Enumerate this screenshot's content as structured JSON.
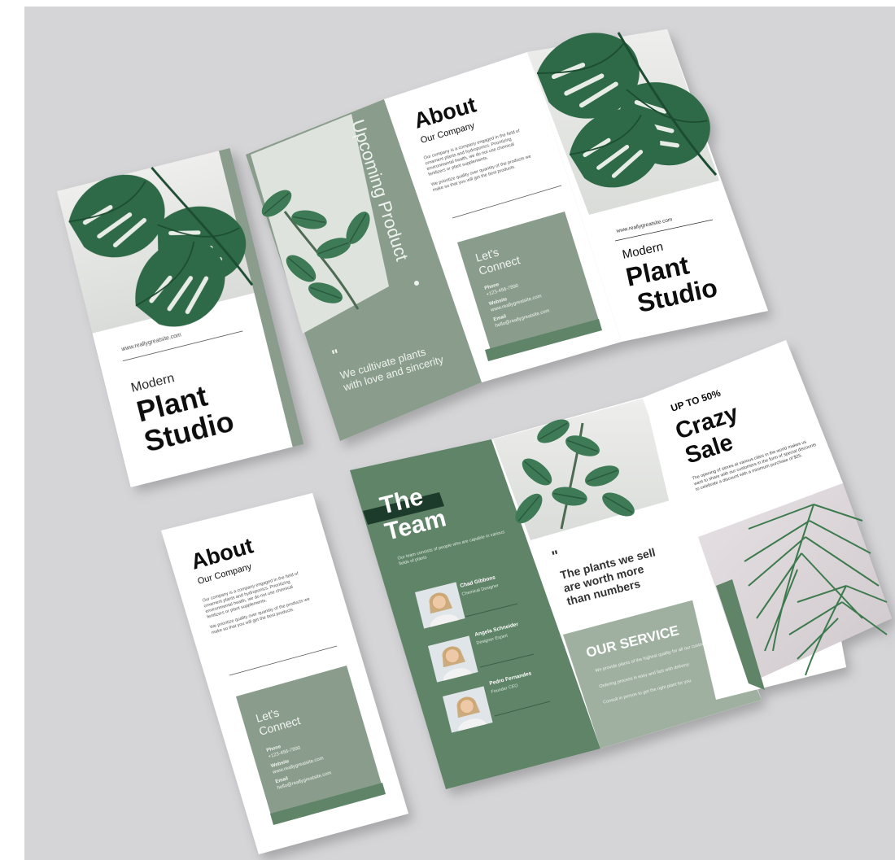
{
  "colors": {
    "background": "#d5d5d8",
    "sage": "#8a9d8c",
    "sage_light": "#9fb0a1",
    "forest": "#5f8468",
    "leaf_dark": "#2f6b47",
    "leaf_mid": "#4d8a62",
    "paper": "#ffffff",
    "text_dark": "#1b1b1b"
  },
  "icons": [
    "monstera-leaf-icon",
    "rubber-plant-icon",
    "palm-frond-icon",
    "quote-mark-icon",
    "portrait-avatar-icon"
  ],
  "website": "www.reallygreatsite.com",
  "brand": {
    "line1": "Modern",
    "line2": "Plant",
    "line3": "Studio"
  },
  "about": {
    "title": "About",
    "subtitle": "Our Company",
    "paragraph1": "Our company is a company engaged in the field of ornament plants and hydroponics. Prioritizing environmental health, we do not use chemical fertilizers or plant supplements.",
    "paragraph2": "We prioritize quality over quantity of the products we make so that you will get the best products."
  },
  "connect": {
    "title_line1": "Let's",
    "title_line2": "Connect",
    "phone_label": "Phone",
    "phone_value": "+123-456-7890",
    "website_label": "Website",
    "website_value": "www.reallygreatsite.com",
    "email_label": "Email",
    "email_value": "hello@reallygreatsite.com"
  },
  "upcoming": {
    "vertical_title": "Upcoming Product",
    "quote": "We cultivate plants with love and sincerity"
  },
  "team": {
    "title_line1": "The",
    "title_line2": "Team",
    "intro": "Our team consists of people who are capable in various fields of plants",
    "members": [
      {
        "name": "Chad Gibbons",
        "role": "Chemical Designer"
      },
      {
        "name": "Angela Schneider",
        "role": "Designer Expert"
      },
      {
        "name": "Pedro Fernandes",
        "role": "Founder CEO"
      }
    ]
  },
  "quote2": {
    "mark": "\"",
    "line1": "The plants we sell",
    "line2": "are worth more",
    "line3": "than numbers"
  },
  "sale": {
    "upto": "UP TO 50%",
    "line1": "Crazy",
    "line2": "Sale",
    "body": "The opening of stores at various cities in the world makes us want to share with our customers in the form of special discounts to celebrate a discount with a minimum purchase of $25."
  },
  "service": {
    "title": "OUR SERVICE",
    "items": [
      "We provide plants of the highest quality for all our customers",
      "Ordering process is easy and fast with delivery",
      "Consult in person to get the right plant for you"
    ]
  }
}
